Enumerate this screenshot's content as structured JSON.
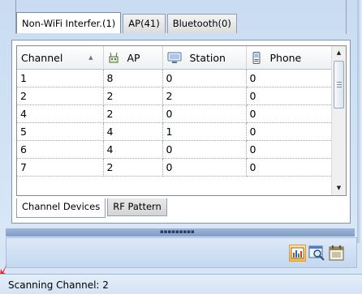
{
  "top_tabs": [
    {
      "label": "Non-WiFi Interfer.(1)",
      "active": true
    },
    {
      "label": "AP(41)",
      "active": false
    },
    {
      "label": "Bluetooth(0)",
      "active": false
    }
  ],
  "grid": {
    "columns": [
      {
        "label": "Channel",
        "icon": "sort-ascending-icon"
      },
      {
        "label": "AP",
        "icon": "access-point-icon"
      },
      {
        "label": "Station",
        "icon": "monitor-icon"
      },
      {
        "label": "Phone",
        "icon": "phone-icon"
      }
    ],
    "rows": [
      [
        "1",
        "8",
        "0",
        "0"
      ],
      [
        "2",
        "2",
        "2",
        "0"
      ],
      [
        "4",
        "2",
        "0",
        "0"
      ],
      [
        "5",
        "4",
        "1",
        "0"
      ],
      [
        "6",
        "4",
        "0",
        "0"
      ],
      [
        "7",
        "2",
        "0",
        "0"
      ]
    ]
  },
  "bottom_tabs": [
    {
      "label": "Channel Devices",
      "active": true
    },
    {
      "label": "RF Pattern",
      "active": false
    }
  ],
  "toolbar": {
    "buttons": [
      "bar-chart-icon",
      "search-window-icon",
      "calendar-icon"
    ]
  },
  "status": {
    "text": "Scanning Channel: 2"
  },
  "colors": {
    "background": "#d7e6f6",
    "accent_border": "#7f96b8",
    "active_tool": "#f7b94c"
  }
}
